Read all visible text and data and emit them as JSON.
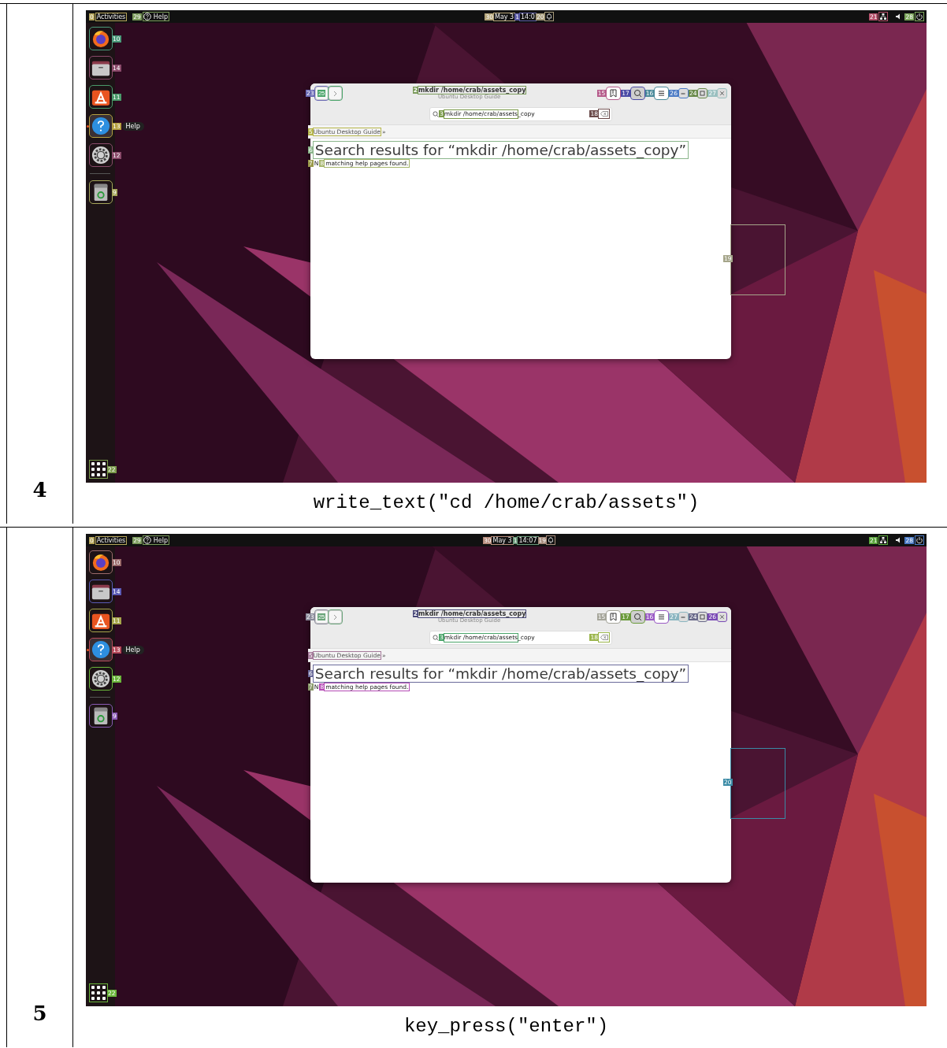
{
  "steps": [
    {
      "number": "4",
      "caption": "write_text(\"cd /home/crab/assets\")",
      "screen": {
        "topbar": {
          "activities": {
            "label": "Activities",
            "mark": {
              "text": "0",
              "color": "#b5a55a"
            }
          },
          "app_menu": {
            "label": "Help",
            "mark": {
              "text": "29",
              "color": "#7a9a5a"
            }
          },
          "date": {
            "label": "May 3",
            "mark": {
              "text": "30",
              "color": "#b5a57a"
            }
          },
          "clock": {
            "label": "14:0",
            "mark": {
              "text": "1",
              "color": "#5a5aa5"
            }
          },
          "notifications": {
            "mark": {
              "text": "20",
              "color": "#a59a7a"
            }
          },
          "network": {
            "mark": {
              "text": "21",
              "color": "#b5506a"
            }
          },
          "power": {
            "mark": {
              "text": "28",
              "color": "#7aa55a"
            }
          }
        },
        "dock": [
          {
            "kind": "browser",
            "active": false,
            "mark": {
              "text": "10",
              "color": "#4a9a7a"
            }
          },
          {
            "kind": "files",
            "active": false,
            "mark": {
              "text": "14",
              "color": "#8a4a6a"
            }
          },
          {
            "kind": "store",
            "active": false,
            "mark": {
              "text": "11",
              "color": "#4a9a6a"
            }
          },
          {
            "kind": "help",
            "active": true,
            "tooltip": "Help",
            "mark": {
              "text": "13",
              "color": "#b5a040"
            }
          },
          {
            "kind": "settings",
            "active": false,
            "mark": {
              "text": "12",
              "color": "#8a4a6a"
            }
          },
          {
            "kind": "trash",
            "active": false,
            "mark": {
              "text": "9",
              "color": "#a5a55a"
            }
          }
        ],
        "apps_button": {
          "mark": {
            "text": "22",
            "color": "#7a9a4a"
          }
        },
        "window": {
          "back": {
            "mark": {
              "text": "23",
              "color": "#6a6ab5"
            },
            "inner_mark": {
              "text": "25",
              "color": "#4aa56a"
            }
          },
          "title": {
            "label": "mkdir /home/crab/assets_copy",
            "mark": {
              "text": "2",
              "color": "#7a9a5a"
            }
          },
          "subtitle": "Ubuntu Desktop Guide",
          "header_buttons": [
            {
              "kind": "bookmarks",
              "pressed": false,
              "mark": {
                "text": "15",
                "color": "#b55a8a"
              }
            },
            {
              "kind": "search",
              "pressed": true,
              "mark": {
                "text": "17",
                "color": "#4a4aa5"
              }
            },
            {
              "kind": "menu",
              "pressed": false,
              "mark": {
                "text": "16",
                "color": "#4a8a9a"
              }
            },
            {
              "kind": "minimize",
              "pressed": false,
              "mark": {
                "text": "26",
                "color": "#4a7ac5"
              }
            },
            {
              "kind": "maximize",
              "pressed": false,
              "mark": {
                "text": "24",
                "color": "#6a8a4a"
              }
            },
            {
              "kind": "close",
              "pressed": false,
              "mark": {
                "text": "27",
                "color": "#9ac0c0"
              }
            }
          ],
          "search": {
            "value_marked": "mkdir /home/crab/assets",
            "value_rest": "_copy",
            "mark": {
              "text": "3",
              "color": "#7a9a4a"
            },
            "clear_mark": {
              "text": "18",
              "color": "#6a4a4a"
            }
          },
          "breadcrumb": {
            "label": "Ubuntu Desktop Guide",
            "separator": "»",
            "mark": {
              "text": "5",
              "color": "#b5b54a"
            }
          },
          "heading": {
            "label": "Search results for “mkdir /home/crab/assets_copy”",
            "mark": {
              "text": "6",
              "color": "#8ab58a"
            }
          },
          "message": {
            "first": "N",
            "rest": "matching help pages found.",
            "first_mark": {
              "text": "7",
              "color": "#9a9a4a"
            },
            "rest_mark": {
              "text": "8",
              "color": "#a5b56a"
            }
          }
        },
        "side_region": {
          "mark": {
            "text": "19",
            "color": "#a5a58a"
          }
        }
      }
    },
    {
      "number": "5",
      "caption": "key_press(\"enter\")",
      "screen": {
        "topbar": {
          "activities": {
            "label": "Activities",
            "mark": {
              "text": "0",
              "color": "#b5a55a"
            }
          },
          "app_menu": {
            "label": "Help",
            "mark": {
              "text": "29",
              "color": "#7a9a5a"
            }
          },
          "date": {
            "label": "May 3",
            "mark": {
              "text": "30",
              "color": "#b58a7a"
            }
          },
          "clock": {
            "label": "14:07",
            "mark": {
              "text": "1",
              "color": "#6a9a7a"
            }
          },
          "notifications": {
            "mark": {
              "text": "19",
              "color": "#a58a7a"
            }
          },
          "network": {
            "mark": {
              "text": "21",
              "color": "#5aa53a"
            }
          },
          "power": {
            "mark": {
              "text": "28",
              "color": "#4a7ac5"
            }
          }
        },
        "dock": [
          {
            "kind": "browser",
            "active": false,
            "mark": {
              "text": "10",
              "color": "#9a6a6a"
            }
          },
          {
            "kind": "files",
            "active": false,
            "mark": {
              "text": "14",
              "color": "#5a5ab5"
            }
          },
          {
            "kind": "store",
            "active": false,
            "mark": {
              "text": "11",
              "color": "#a5a54a"
            }
          },
          {
            "kind": "help",
            "active": true,
            "tooltip": "Help",
            "mark": {
              "text": "13",
              "color": "#b54a5a"
            }
          },
          {
            "kind": "settings",
            "active": false,
            "mark": {
              "text": "12",
              "color": "#6ab53a"
            }
          },
          {
            "kind": "trash",
            "active": false,
            "mark": {
              "text": "9",
              "color": "#8a5ab5"
            }
          }
        ],
        "apps_button": {
          "mark": {
            "text": "22",
            "color": "#6ab53a"
          }
        },
        "window": {
          "back": {
            "mark": {
              "text": "23",
              "color": "#8a8a9a"
            },
            "inner_mark": {
              "text": "25",
              "color": "#6aa57a"
            }
          },
          "title": {
            "label": "mkdir /home/crab/assets_copy",
            "mark": {
              "text": "2",
              "color": "#4a4a7a"
            }
          },
          "subtitle": "Ubuntu Desktop Guide",
          "header_buttons": [
            {
              "kind": "bookmarks",
              "pressed": false,
              "mark": {
                "text": "15",
                "color": "#a5a59a"
              }
            },
            {
              "kind": "search",
              "pressed": true,
              "mark": {
                "text": "17",
                "color": "#6a9a3a"
              }
            },
            {
              "kind": "menu",
              "pressed": false,
              "mark": {
                "text": "16",
                "color": "#9a5ac5"
              }
            },
            {
              "kind": "minimize",
              "pressed": false,
              "mark": {
                "text": "27",
                "color": "#8ab5c0"
              }
            },
            {
              "kind": "maximize",
              "pressed": false,
              "mark": {
                "text": "24",
                "color": "#6a6a8a"
              }
            },
            {
              "kind": "close",
              "pressed": false,
              "mark": {
                "text": "26",
                "color": "#7a4ab5"
              }
            }
          ],
          "search": {
            "value_marked": "mkdir /home/crab/assets",
            "value_rest": "_copy",
            "mark": {
              "text": "3",
              "color": "#4aa56a"
            },
            "clear_mark": {
              "text": "18",
              "color": "#9ab54a"
            }
          },
          "breadcrumb": {
            "label": "Ubuntu Desktop Guide",
            "separator": "»",
            "mark": {
              "text": "5",
              "color": "#a57a9a"
            }
          },
          "heading": {
            "label": "Search results for “mkdir /home/crab/assets_copy”",
            "mark": {
              "text": "6",
              "color": "#6a6a9a"
            }
          },
          "message": {
            "first": "N",
            "rest": "matching help pages found.",
            "first_mark": {
              "text": "7",
              "color": "#8a9a6a"
            },
            "rest_mark": {
              "text": "8",
              "color": "#b54ab5"
            }
          }
        },
        "side_region": {
          "mark": {
            "text": "20",
            "color": "#3a8aa5"
          }
        }
      }
    }
  ]
}
